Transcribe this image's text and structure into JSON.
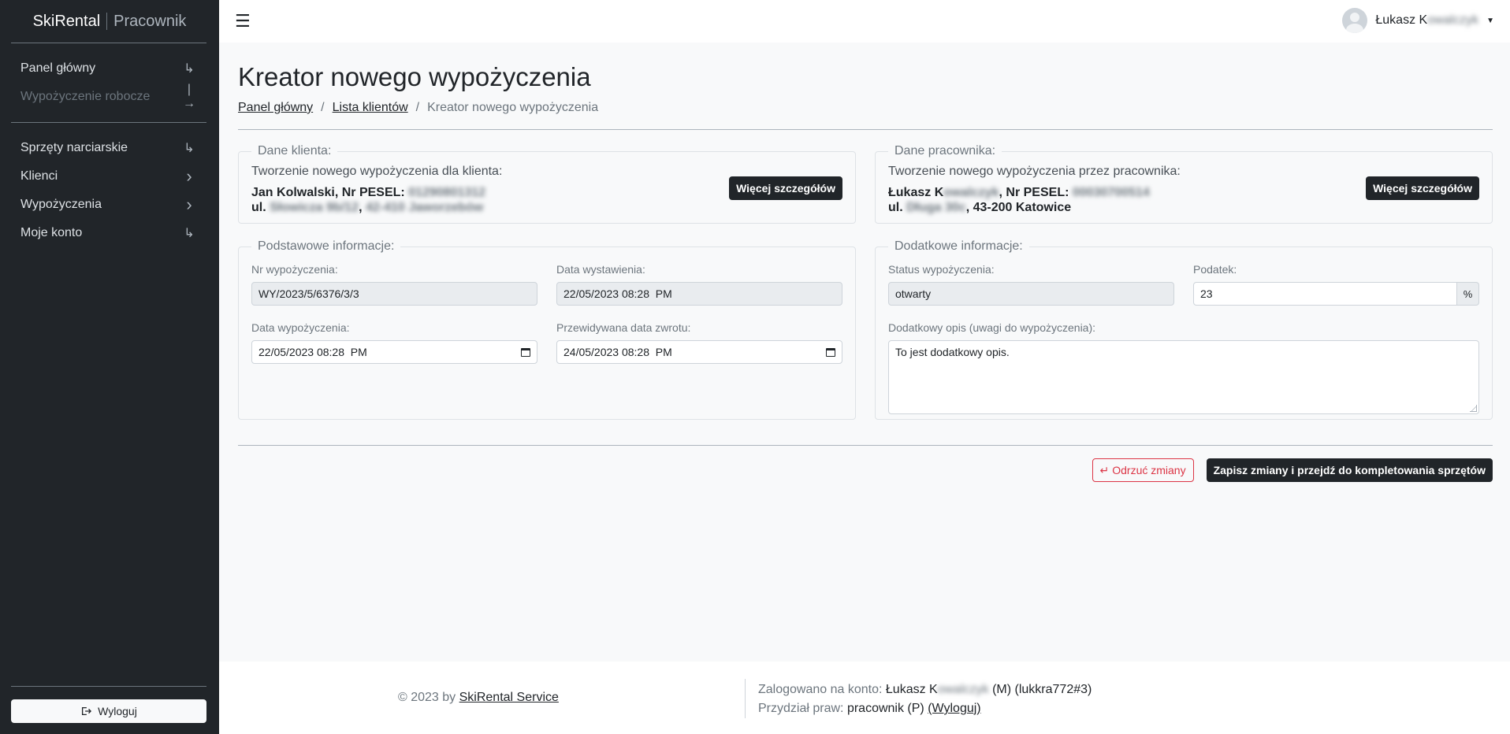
{
  "sidebar": {
    "brand_name": "SkiRental",
    "brand_role": "Pracownik",
    "group1": [
      {
        "label": "Panel główny",
        "icon": "↳"
      },
      {
        "label": "Wypożyczenie robocze",
        "icon": "|→"
      }
    ],
    "group2": [
      {
        "label": "Sprzęty narciarskie",
        "icon": "↳"
      },
      {
        "label": "Klienci",
        "icon": "›"
      },
      {
        "label": "Wypożyczenia",
        "icon": "›"
      },
      {
        "label": "Moje konto",
        "icon": "↳"
      }
    ],
    "logout_label": "Wyloguj"
  },
  "topbar": {
    "user_first": "Łukasz K",
    "user_rest": "owalczyk"
  },
  "page": {
    "title": "Kreator nowego wypożyczenia",
    "breadcrumb": [
      "Panel główny",
      "Lista klientów",
      "Kreator nowego wypożyczenia"
    ],
    "breadcrumb_sep": "/"
  },
  "client": {
    "legend": "Dane klienta:",
    "intro": "Tworzenie nowego wypożyczenia dla klienta:",
    "name": "Jan Kolwalski, Nr PESEL:",
    "pesel": "01290801312",
    "addr_prefix": "ul.",
    "street": "Słowicza 9b/12",
    "comma": ",",
    "city": "42-410 Jaworzebów",
    "details_btn": "Więcej szczegółów"
  },
  "employee": {
    "legend": "Dane pracownika:",
    "intro": "Tworzenie nowego wypożyczenia przez pracownika:",
    "name_first": "Łukasz K",
    "name_rest": "owalczyk",
    "pesel_label": ", Nr PESEL:",
    "pesel": "00030700514",
    "addr_prefix": "ul.",
    "street": "Długa 30c",
    "city": ", 43-200 Katowice",
    "details_btn": "Więcej szczegółów"
  },
  "basic": {
    "legend": "Podstawowe informacje:",
    "nr_label": "Nr wypożyczenia:",
    "nr_value": "WY/2023/5/6376/3/3",
    "issue_label": "Data wystawienia:",
    "issue_value": "22/05/2023 08:28  PM",
    "rent_label": "Data wypożyczenia:",
    "rent_value": "22/05/2023 08:28  PM",
    "return_label": "Przewidywana data zwrotu:",
    "return_value": "24/05/2023 08:28  PM"
  },
  "extra": {
    "legend": "Dodatkowe informacje:",
    "status_label": "Status wypożyczenia:",
    "status_value": "otwarty",
    "tax_label": "Podatek:",
    "tax_value": "23",
    "tax_suffix": "%",
    "desc_label": "Dodatkowy opis (uwagi do wypożyczenia):",
    "desc_value": "To jest dodatkowy opis."
  },
  "actions": {
    "discard": "Odrzuć zmiany",
    "discard_icon": "↵",
    "save": "Zapisz zmiany i przejdź do kompletowania sprzętów"
  },
  "footer": {
    "copyright": "© 2023 by",
    "service_link": "SkiRental Service",
    "logged_label": "Zalogowano na konto:",
    "logged_first": "Łukasz K",
    "logged_rest": "owalczyk",
    "logged_suffix": "(M) (lukkra772#3)",
    "rights_label": "Przydział praw:",
    "rights_value": "pracownik (P)",
    "logout_link": "(Wyloguj)"
  }
}
